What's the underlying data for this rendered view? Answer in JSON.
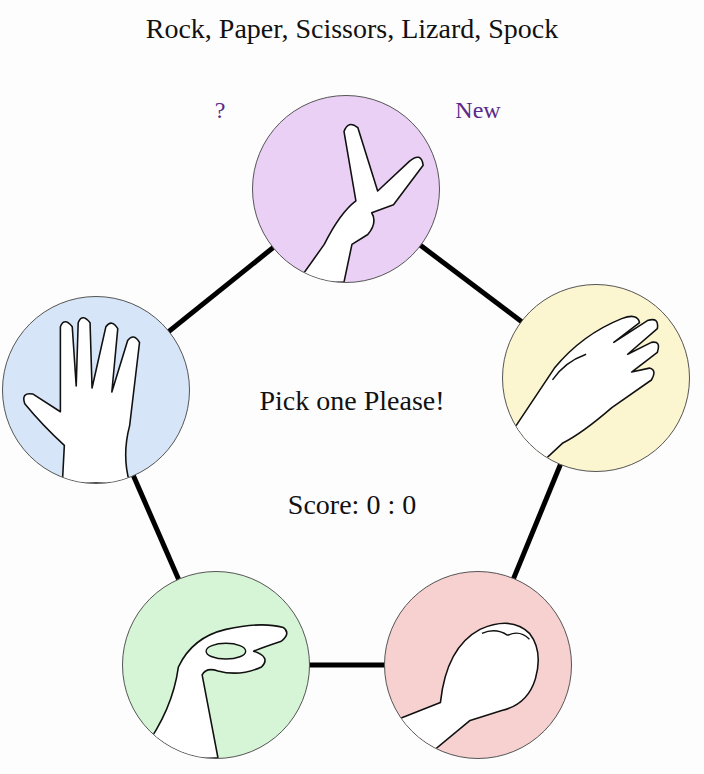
{
  "title": "Rock, Paper, Scissors, Lizard, Spock",
  "help": "?",
  "new_game": "New",
  "message": "Pick one Please!",
  "score": {
    "label": "Score:",
    "player": "0",
    "separator": ":",
    "computer": "0"
  },
  "choices": [
    {
      "kind": "scissors",
      "color": "#ebd0f6"
    },
    {
      "kind": "paper",
      "color": "#fbf5d0"
    },
    {
      "kind": "rock",
      "color": "#f7d0d0"
    },
    {
      "kind": "lizard",
      "color": "#d6f5d6"
    },
    {
      "kind": "spock",
      "color": "#d6e6f8"
    }
  ]
}
